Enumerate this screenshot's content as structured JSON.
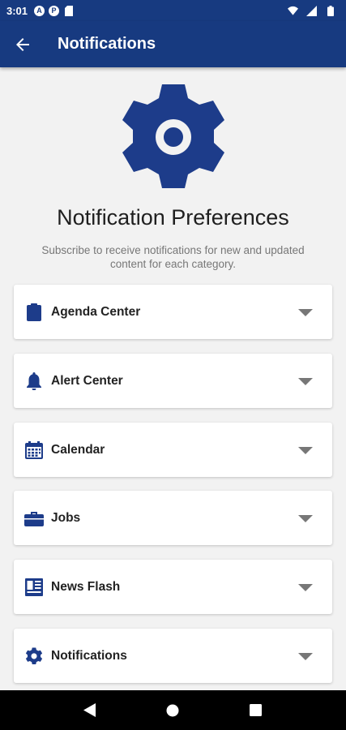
{
  "status_bar": {
    "time": "3:01",
    "badges": [
      "A",
      "P"
    ]
  },
  "app_bar": {
    "title": "Notifications",
    "back_icon": "arrow-left-icon"
  },
  "hero": {
    "icon": "gear-icon",
    "heading": "Notification Preferences",
    "subtext": "Subscribe to receive notifications for new and updated content for each category."
  },
  "categories": [
    {
      "label": "Agenda Center",
      "icon": "clipboard-icon"
    },
    {
      "label": "Alert Center",
      "icon": "bell-icon"
    },
    {
      "label": "Calendar",
      "icon": "calendar-icon"
    },
    {
      "label": "Jobs",
      "icon": "briefcase-icon"
    },
    {
      "label": "News Flash",
      "icon": "newspaper-icon"
    },
    {
      "label": "Notifications",
      "icon": "gear-icon"
    }
  ],
  "colors": {
    "primary": "#173a80",
    "icon": "#1d3c8a",
    "chevron": "#777777"
  }
}
